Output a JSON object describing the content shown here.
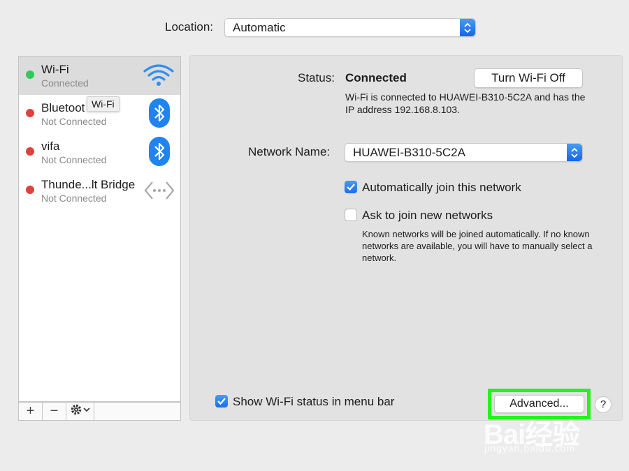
{
  "location": {
    "label": "Location:",
    "value": "Automatic"
  },
  "sidebar": {
    "services": [
      {
        "name": "Wi-Fi",
        "status": "Connected",
        "dot_color": "#34c759",
        "icon": "wifi-icon"
      },
      {
        "name": "Bluetoot",
        "status": "Not Connected",
        "dot_color": "#e0413a",
        "icon": "bluetooth-icon"
      },
      {
        "name": "vifa",
        "status": "Not Connected",
        "dot_color": "#e0413a",
        "icon": "bluetooth-icon"
      },
      {
        "name": "Thunde...lt Bridge",
        "status": "Not Connected",
        "dot_color": "#e0413a",
        "icon": "thunderbolt-bridge-icon"
      }
    ],
    "tooltip": "Wi-Fi",
    "toolbar": {
      "add": "+",
      "remove": "−",
      "gear_icon": "gear-icon"
    }
  },
  "main": {
    "status_label": "Status:",
    "status_value": "Connected",
    "turn_off_label": "Turn Wi-Fi Off",
    "status_desc": "Wi-Fi is connected to HUAWEI-B310-5C2A and has the IP address 192.168.8.103.",
    "network_name_label": "Network Name:",
    "network_name_value": "HUAWEI-B310-5C2A",
    "auto_join_label": "Automatically join this network",
    "auto_join_checked": true,
    "ask_join_label": "Ask to join new networks",
    "ask_join_checked": false,
    "ask_join_note": "Known networks will be joined automatically. If no known networks are available, you will have to manually select a network."
  },
  "footer": {
    "show_status_label": "Show Wi-Fi status in menu bar",
    "show_status_checked": true,
    "advanced_label": "Advanced...",
    "help_label": "?"
  },
  "colors": {
    "accent": "#1b6fe8",
    "highlight": "#22f51b",
    "connected": "#34c759",
    "disconnected": "#e0413a"
  },
  "watermark": {
    "brand": "Bai经验",
    "url": "jingyan.baidu.com"
  }
}
